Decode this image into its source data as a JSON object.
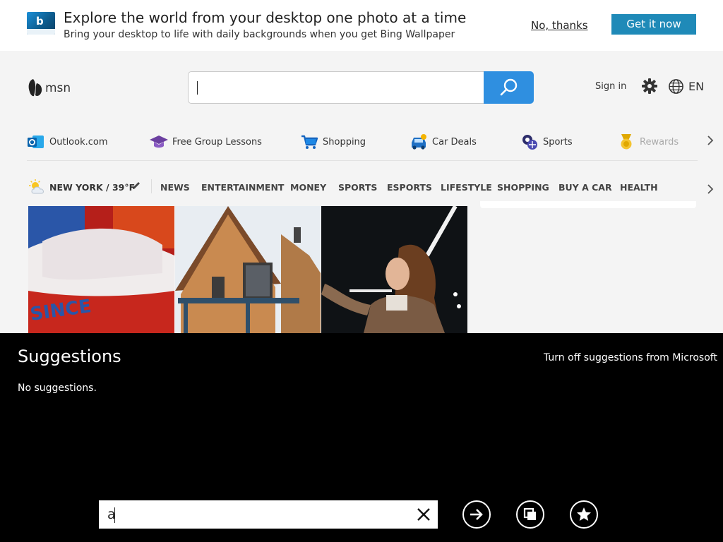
{
  "banner": {
    "title": "Explore the world from your desktop one photo at a time",
    "subtitle": "Bring your desktop to life with daily backgrounds when you get Bing Wallpaper",
    "no_thanks": "No, thanks",
    "get_it": "Get it now",
    "logo_letter": "b",
    "accent": "#1f8ab8"
  },
  "header": {
    "brand": "msn",
    "search_value": "",
    "sign_in": "Sign in",
    "language": "EN",
    "search_button_color": "#2f8fe0"
  },
  "quick_links": [
    {
      "label": "Outlook.com",
      "icon": "outlook-icon"
    },
    {
      "label": "Free Group Lessons",
      "icon": "graduation-cap-icon"
    },
    {
      "label": "Shopping",
      "icon": "shopping-cart-icon"
    },
    {
      "label": "Car Deals",
      "icon": "car-icon"
    },
    {
      "label": "Sports",
      "icon": "sports-ball-icon"
    },
    {
      "label": "Rewards",
      "icon": "rewards-medal-icon"
    }
  ],
  "weather": {
    "label": "NEW YORK / 39°F",
    "icon": "partly-sunny-icon"
  },
  "nav": [
    "NEWS",
    "ENTERTAINMENT",
    "MONEY",
    "SPORTS",
    "ESPORTS",
    "LIFESTYLE",
    "SHOPPING",
    "BUY A CAR",
    "HEALTH"
  ],
  "images": {
    "sneaker_text": "SINCE"
  },
  "suggestions": {
    "title": "Suggestions",
    "turn_off": "Turn off suggestions from Microsoft",
    "empty": "No suggestions."
  },
  "address_bar": {
    "value": "a"
  }
}
